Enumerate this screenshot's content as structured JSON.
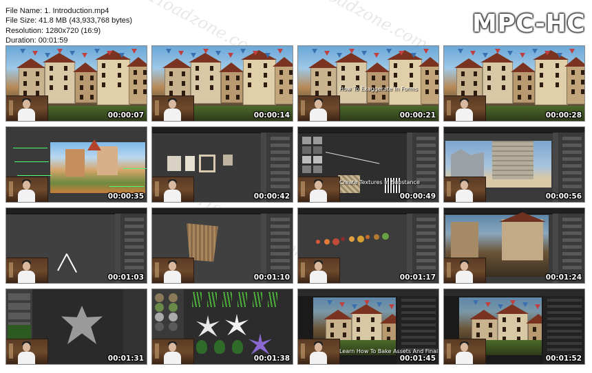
{
  "file_info": {
    "name_line": "File Name: 1. Introduction.mp4",
    "size_line": "File Size: 41.8 MB (43,933,768 bytes)",
    "resolution_line": "Resolution: 1280x720 (16:9)",
    "duration_line": "Duration: 00:01:59"
  },
  "logo": "MPC-HC",
  "watermark": "Hoadzone.com",
  "thumbnails": [
    {
      "time": "00:00:07",
      "scene": "town",
      "caption": ""
    },
    {
      "time": "00:00:14",
      "scene": "town",
      "caption": ""
    },
    {
      "time": "00:00:21",
      "scene": "town",
      "caption": "How To Exaggerate In Forms"
    },
    {
      "time": "00:00:28",
      "scene": "town",
      "caption": ""
    },
    {
      "time": "00:00:35",
      "scene": "painting",
      "caption": ""
    },
    {
      "time": "00:00:42",
      "scene": "blender-planes",
      "caption": ""
    },
    {
      "time": "00:00:49",
      "scene": "blender-textures",
      "caption": "Create Textures In Substance"
    },
    {
      "time": "00:00:56",
      "scene": "blender-ruin",
      "caption": ""
    },
    {
      "time": "00:01:03",
      "scene": "blender-curve",
      "caption": ""
    },
    {
      "time": "00:01:10",
      "scene": "blender-basket",
      "caption": ""
    },
    {
      "time": "00:01:17",
      "scene": "blender-fruits",
      "caption": ""
    },
    {
      "time": "00:01:24",
      "scene": "blender-town",
      "caption": ""
    },
    {
      "time": "00:01:31",
      "scene": "zbrush-leaf",
      "caption": ""
    },
    {
      "time": "00:01:38",
      "scene": "foliage",
      "caption": ""
    },
    {
      "time": "00:01:45",
      "scene": "ue-town",
      "caption": "Learn How To Bake Assets And Finally..."
    },
    {
      "time": "00:01:52",
      "scene": "ue-town",
      "caption": ""
    }
  ]
}
